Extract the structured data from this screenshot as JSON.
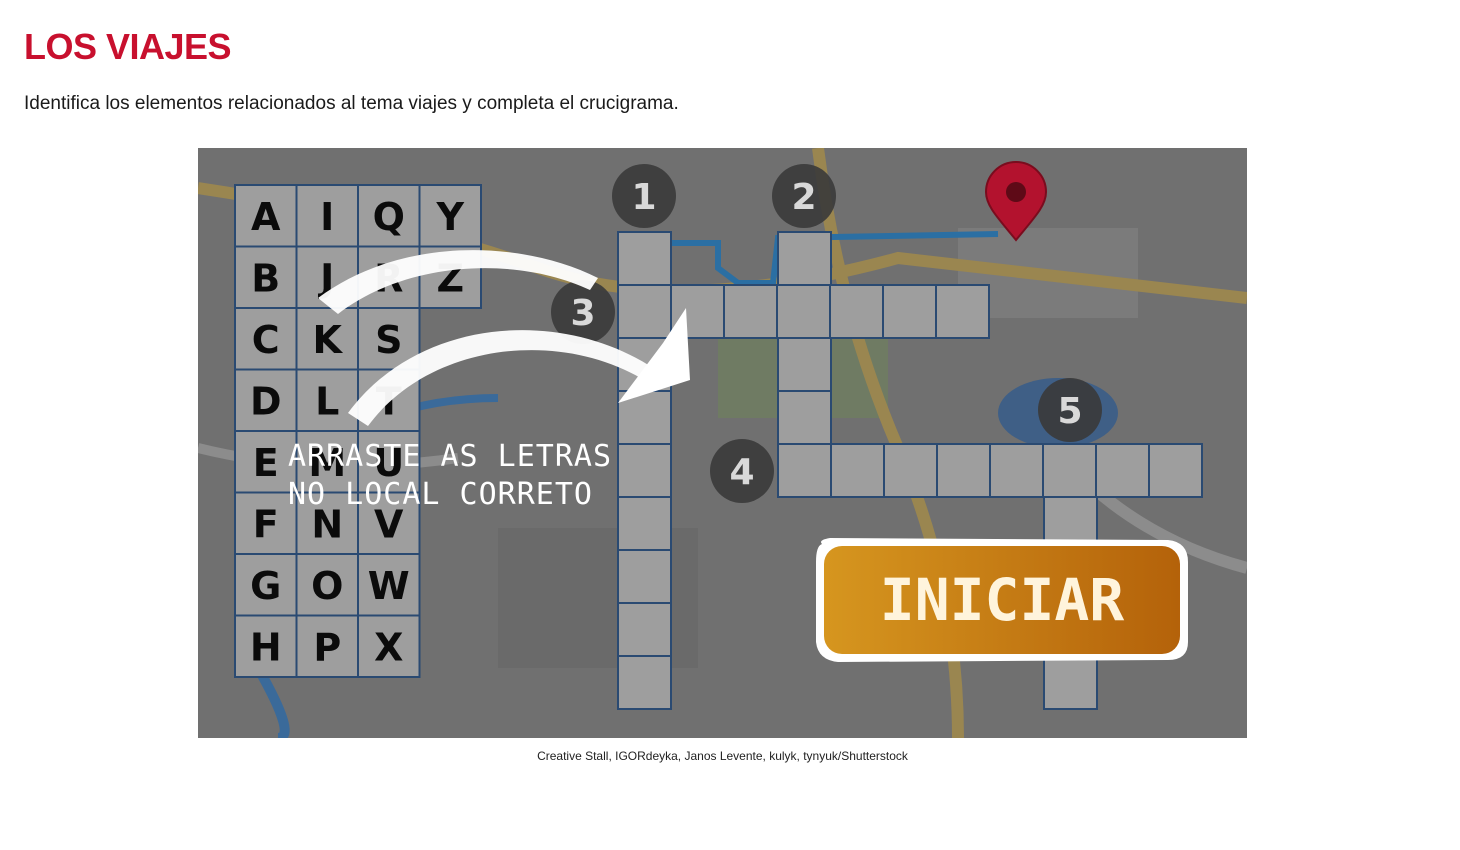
{
  "page": {
    "title": "LOS VIAJES",
    "instruction": "Identifica los elementos relacionados al tema viajes y completa el crucigrama.",
    "credit": "Creative Stall, IGORdeyka, Janos Levente, kulyk, tynyuk/Shutterstock"
  },
  "game": {
    "letters": [
      [
        "A",
        "I",
        "Q",
        "Y"
      ],
      [
        "B",
        "J",
        "R",
        "Z"
      ],
      [
        "C",
        "K",
        "S",
        ""
      ],
      [
        "D",
        "L",
        "T",
        ""
      ],
      [
        "E",
        "M",
        "U",
        ""
      ],
      [
        "F",
        "N",
        "V",
        ""
      ],
      [
        "G",
        "O",
        "W",
        ""
      ],
      [
        "H",
        "P",
        "X",
        ""
      ]
    ],
    "clue_numbers": [
      "1",
      "2",
      "3",
      "4",
      "5"
    ],
    "hint_line1": "ARRASTE AS LETRAS",
    "hint_line2": "NO LOCAL CORRETO",
    "start_label": "INICIAR",
    "icons": {
      "map_pin": "map-pin-icon",
      "arrow": "curved-arrow-icon"
    }
  },
  "colors": {
    "title": "#c8102e",
    "cell": "#9e9e9e",
    "cell_border": "#2a4a72",
    "button": "#c9861a",
    "pin": "#b3122e"
  }
}
